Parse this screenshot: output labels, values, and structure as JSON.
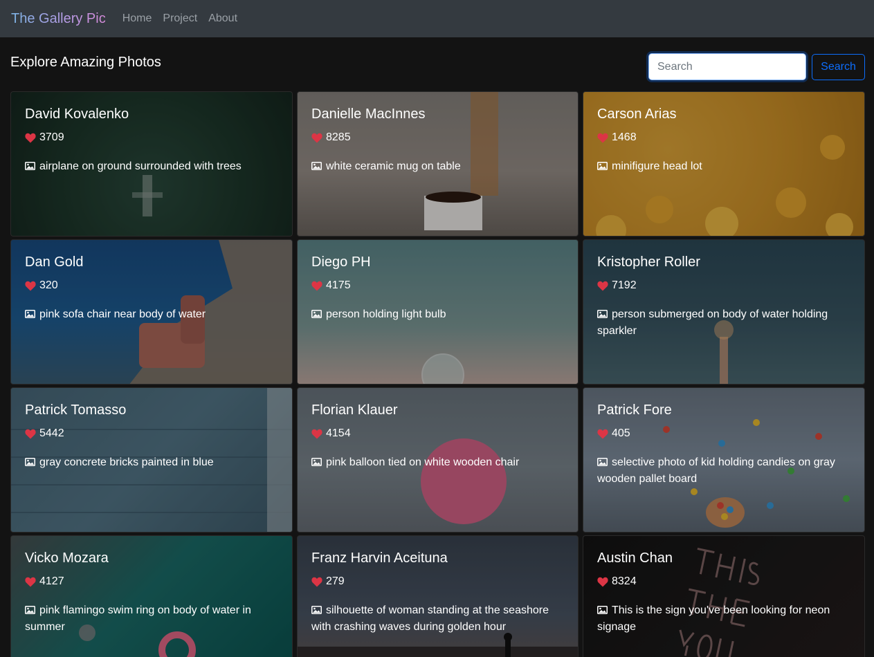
{
  "nav": {
    "brand": "The Gallery Pic",
    "links": [
      "Home",
      "Project",
      "About"
    ]
  },
  "heading": "Explore Amazing Photos",
  "search": {
    "placeholder": "Search",
    "value": "",
    "button_label": "Search"
  },
  "colors": {
    "navbar_bg": "#343a40",
    "page_bg": "#131313",
    "accent_blue": "#0d6efd",
    "heart_red": "#dc3545"
  },
  "icons": {
    "likes": "heart-icon",
    "description": "image-icon"
  },
  "cards": [
    {
      "name": "David Kovalenko",
      "likes": "3709",
      "description": "airplane on ground surrounded with trees"
    },
    {
      "name": "Danielle MacInnes",
      "likes": "8285",
      "description": "white ceramic mug on table"
    },
    {
      "name": "Carson Arias",
      "likes": "1468",
      "description": "minifigure head lot"
    },
    {
      "name": "Dan Gold",
      "likes": "320",
      "description": "pink sofa chair near body of water"
    },
    {
      "name": "Diego PH",
      "likes": "4175",
      "description": "person holding light bulb"
    },
    {
      "name": "Kristopher Roller",
      "likes": "7192",
      "description": "person submerged on body of water holding sparkler"
    },
    {
      "name": "Patrick Tomasso",
      "likes": "5442",
      "description": "gray concrete bricks painted in blue"
    },
    {
      "name": "Florian Klauer",
      "likes": "4154",
      "description": "pink balloon tied on white wooden chair"
    },
    {
      "name": "Patrick Fore",
      "likes": "405",
      "description": "selective photo of kid holding candies on gray wooden pallet board"
    },
    {
      "name": "Vicko Mozara",
      "likes": "4127",
      "description": "pink flamingo swim ring on body of water in summer"
    },
    {
      "name": "Franz Harvin Aceituna",
      "likes": "279",
      "description": "silhouette of woman standing at the seashore with crashing waves during golden hour"
    },
    {
      "name": "Austin Chan",
      "likes": "8324",
      "description": "This is the sign you've been looking for neon signage"
    }
  ]
}
